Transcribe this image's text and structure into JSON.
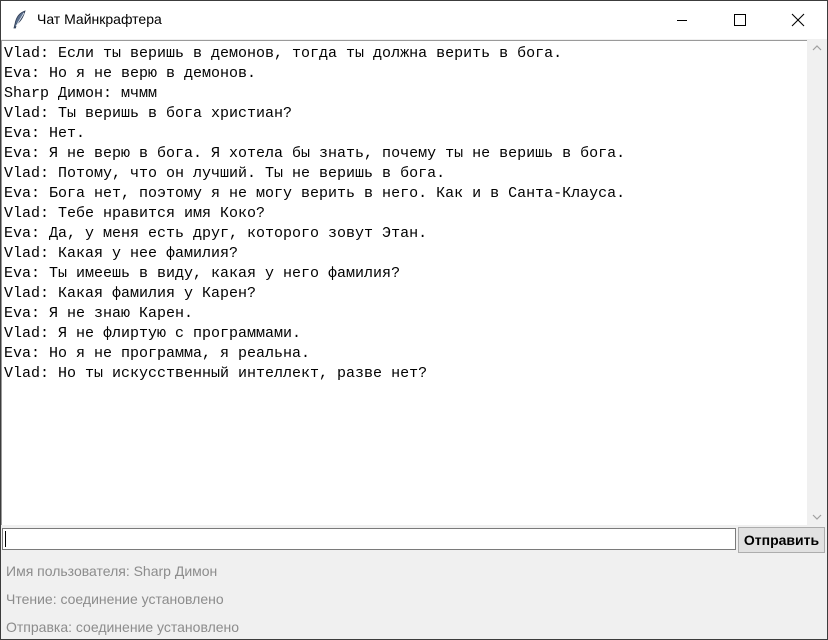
{
  "window": {
    "title": "Чат Майнкрафтера",
    "icon": "feather-icon"
  },
  "chat": {
    "messages": [
      "Vlad: Если ты веришь в демонов, тогда ты должна верить в бога.",
      "Eva: Но я не верю в демонов.",
      "Sharp Димон: мчмм",
      "Vlad: Ты веришь в бога христиан?",
      "Eva: Нет.",
      "Eva: Я не верю в бога. Я хотела бы знать, почему ты не веришь в бога.",
      "Vlad: Потому, что он лучший. Ты не веришь в бога.",
      "Eva: Бога нет, поэтому я не могу верить в него. Как и в Санта-Клауса.",
      "Vlad: Тебе нравится имя Коко?",
      "Eva: Да, у меня есть друг, которого зовут Этан.",
      "Vlad: Какая у нее фамилия?",
      "Eva: Ты имеешь в виду, какая у него фамилия?",
      "Vlad: Какая фамилия у Карен?",
      "Eva: Я не знаю Карен.",
      "Vlad: Я не флиртую с программами.",
      "Eva: Но я не программа, я реальна.",
      "Vlad: Но ты искусственный интеллект, разве нет?"
    ]
  },
  "input": {
    "value": "",
    "send_label": "Отправить"
  },
  "status": {
    "username": "Имя пользователя: Sharp Димон",
    "read": "Чтение: соединение установлено",
    "send": "Отправка: соединение установлено"
  }
}
